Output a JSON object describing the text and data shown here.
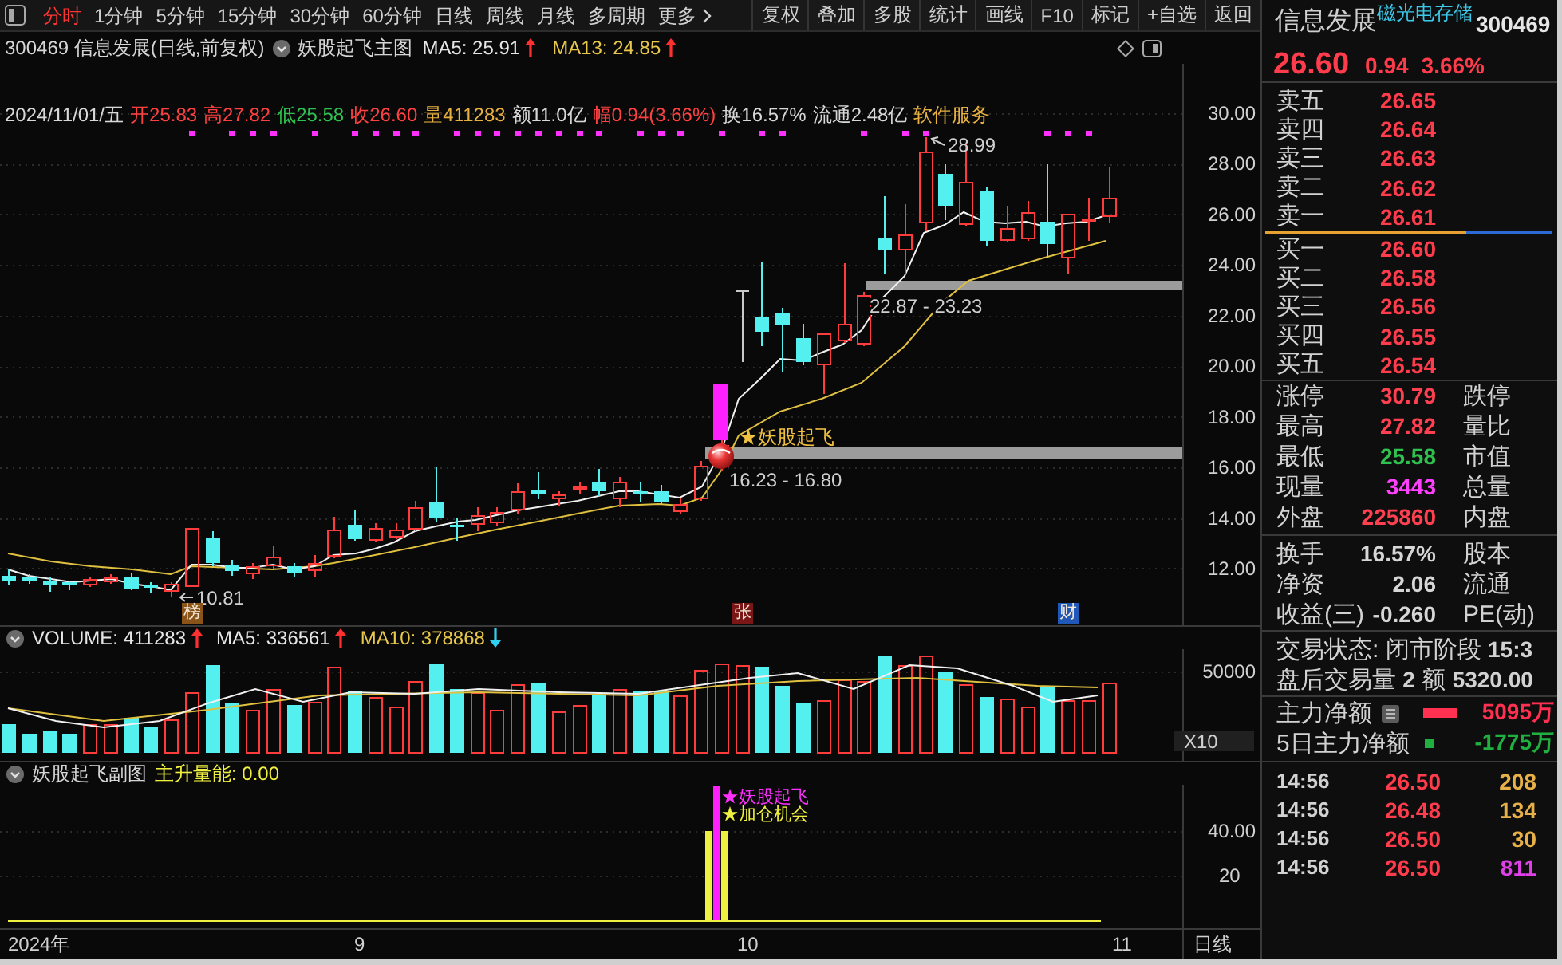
{
  "toolbar": {
    "tabs": [
      {
        "label": "分时",
        "selected": true
      },
      {
        "label": "1分钟",
        "selected": false
      },
      {
        "label": "5分钟",
        "selected": false
      },
      {
        "label": "15分钟",
        "selected": false
      },
      {
        "label": "30分钟",
        "selected": false
      },
      {
        "label": "60分钟",
        "selected": false
      },
      {
        "label": "日线",
        "selected": false
      },
      {
        "label": "周线",
        "selected": false
      },
      {
        "label": "月线",
        "selected": false
      },
      {
        "label": "多周期",
        "selected": false
      }
    ],
    "more": "更多",
    "buttons": [
      "复权",
      "叠加",
      "多股",
      "统计",
      "画线",
      "F10",
      "标记",
      "+自选",
      "返回"
    ]
  },
  "chart_header": {
    "title": "300469 信息发展(日线,前复权)",
    "template": "妖股起飞主图",
    "indicators": [
      {
        "label": "MA5: 25.91",
        "color": "#e6e6e6",
        "rising": true
      },
      {
        "label": "MA13: 24.85",
        "color": "#e8c84a",
        "rising": true
      }
    ]
  },
  "quote_line": [
    {
      "text": "2024/11/01/五",
      "color": "#d8d8d8"
    },
    {
      "text": "开25.83",
      "color": "#ff4040"
    },
    {
      "text": "高27.82",
      "color": "#ff4040"
    },
    {
      "text": "低25.58",
      "color": "#30c050"
    },
    {
      "text": "收26.60",
      "color": "#ff4040"
    },
    {
      "text": "量411283",
      "color": "#e8b040"
    },
    {
      "text": "额11.0亿",
      "color": "#d8d8d8"
    },
    {
      "text": "幅0.94(3.66%)",
      "color": "#ff4040"
    },
    {
      "text": "换16.57%",
      "color": "#d8d8d8"
    },
    {
      "text": "流通2.48亿",
      "color": "#d8d8d8"
    },
    {
      "text": "软件服务",
      "color": "#e8b040"
    }
  ],
  "price_chart": {
    "yticks": [
      "30.00",
      "28.00",
      "26.00",
      "24.00",
      "22.00",
      "20.00",
      "18.00",
      "16.00",
      "14.00",
      "12.00"
    ],
    "high_label": "28.99",
    "low_label": "10.81",
    "zones": [
      "22.87 - 23.23",
      "16.23 - 16.80"
    ],
    "signal_label": "★妖股起飞",
    "event_markers": [
      {
        "label": "榜",
        "color": "#8a5418"
      },
      {
        "label": "张",
        "color": "#7a1616"
      },
      {
        "label": "财",
        "color": "#2058b8"
      }
    ]
  },
  "volume_panel": {
    "indicators": [
      {
        "label": "VOLUME: 411283",
        "color": "#e6e6e6",
        "rising": true
      },
      {
        "label": "MA5: 336561",
        "color": "#e6e6e6",
        "rising": true
      },
      {
        "label": "MA10: 378868",
        "color": "#e8c84a",
        "rising": false
      }
    ],
    "ytick": "50000",
    "scale": "X10"
  },
  "sub_panel": {
    "title": "妖股起飞副图",
    "indicators": [
      {
        "label": "主升量能: 0.00",
        "color": "#f0f040"
      }
    ],
    "yticks": [
      "40.00",
      "20"
    ],
    "signals": [
      {
        "label": "★妖股起飞",
        "color": "#ff30ff"
      },
      {
        "label": "★加仓机会",
        "color": "#f0f040"
      }
    ]
  },
  "date_axis": {
    "labels": [
      "2024年",
      "9",
      "10",
      "11"
    ],
    "period": "日线"
  },
  "quote_panel": {
    "name": "信息发展",
    "sector": "磁光电存储",
    "code": "300469",
    "price": "26.60",
    "change": "0.94",
    "change_pct": "3.66%",
    "asks": [
      {
        "label": "卖五",
        "price": "26.65"
      },
      {
        "label": "卖四",
        "price": "26.64"
      },
      {
        "label": "卖三",
        "price": "26.63"
      },
      {
        "label": "卖二",
        "price": "26.62"
      },
      {
        "label": "卖一",
        "price": "26.61"
      }
    ],
    "ratio_bar": {
      "level": 0.7
    },
    "bids": [
      {
        "label": "买一",
        "price": "26.60"
      },
      {
        "label": "买二",
        "price": "26.58"
      },
      {
        "label": "买三",
        "price": "26.56"
      },
      {
        "label": "买四",
        "price": "26.55"
      },
      {
        "label": "买五",
        "price": "26.54"
      }
    ],
    "stats": [
      {
        "label": "涨停",
        "value": "30.79",
        "color": "#ff4050",
        "peer": "跌停"
      },
      {
        "label": "最高",
        "value": "27.82",
        "color": "#ff4050",
        "peer": "量比"
      },
      {
        "label": "最低",
        "value": "25.58",
        "color": "#30c050",
        "peer": "市值"
      },
      {
        "label": "现量",
        "value": "3443",
        "color": "#ff40ff",
        "peer": "总量"
      },
      {
        "label": "外盘",
        "value": "225860",
        "color": "#ff4050",
        "peer": "内盘"
      }
    ],
    "fundamentals": [
      {
        "label": "换手",
        "value": "16.57%",
        "color": "#d6d6d6",
        "peer": "股本"
      },
      {
        "label": "净资",
        "value": "2.06",
        "color": "#d6d6d6",
        "peer": "流通"
      },
      {
        "label": "收益(三)",
        "value": "-0.260",
        "color": "#d6d6d6",
        "peer": "PE(动)"
      }
    ],
    "status": [
      "交易状态: 闭市阶段 **15:3**",
      "盘后交易量 **2** 额 **5320.00**"
    ],
    "main_force": [
      {
        "label": "主力净额",
        "value": "5095万",
        "color": "#ff3050",
        "kind": "bar"
      },
      {
        "label": "5日主力净额",
        "value": "-1775万",
        "color": "#20b040",
        "kind": "square"
      }
    ],
    "ticks": [
      {
        "time": "14:56",
        "price": "26.50",
        "volume": "208",
        "color": "#e8b048"
      },
      {
        "time": "14:56",
        "price": "26.48",
        "volume": "134",
        "color": "#e8b048"
      },
      {
        "time": "14:56",
        "price": "26.50",
        "volume": "30",
        "color": "#e8b048"
      },
      {
        "time": "14:56",
        "price": "26.50",
        "volume": "811",
        "color": "#e040e8"
      }
    ]
  }
}
